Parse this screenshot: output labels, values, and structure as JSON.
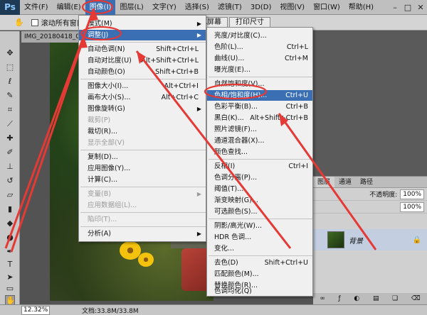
{
  "app": {
    "logo": "Ps"
  },
  "menubar": {
    "items": [
      "文件(F)",
      "编辑(E)",
      "图像(I)",
      "图层(L)",
      "文字(Y)",
      "选择(S)",
      "滤镜(T)",
      "3D(D)",
      "视图(V)",
      "窗口(W)",
      "帮助(H)"
    ],
    "active_index": 2,
    "window_controls": [
      "–",
      "□",
      "✕"
    ]
  },
  "options": {
    "scroll_all_label": "滚动所有窗口",
    "btn_fill_screen": "填充屏幕",
    "btn_print_size": "打印尺寸"
  },
  "document": {
    "tab_title": "IMG_20180418_0"
  },
  "image_menu": {
    "items": [
      {
        "label": "模式(M)",
        "shortcut": "",
        "submenu": true,
        "disabled": false,
        "highlight": false
      },
      {
        "label": "调整(J)",
        "shortcut": "",
        "submenu": true,
        "disabled": false,
        "highlight": true
      },
      {
        "label": "自动色调(N)",
        "shortcut": "Shift+Ctrl+L",
        "submenu": false,
        "disabled": false,
        "highlight": false
      },
      {
        "label": "自动对比度(U)",
        "shortcut": "Alt+Shift+Ctrl+L",
        "submenu": false,
        "disabled": false,
        "highlight": false
      },
      {
        "label": "自动颜色(O)",
        "shortcut": "Shift+Ctrl+B",
        "submenu": false,
        "disabled": false,
        "highlight": false
      },
      {
        "label": "图像大小(I)...",
        "shortcut": "Alt+Ctrl+I",
        "submenu": false,
        "disabled": false,
        "highlight": false
      },
      {
        "label": "画布大小(S)...",
        "shortcut": "Alt+Ctrl+C",
        "submenu": false,
        "disabled": false,
        "highlight": false
      },
      {
        "label": "图像旋转(G)",
        "shortcut": "",
        "submenu": true,
        "disabled": false,
        "highlight": false
      },
      {
        "label": "裁剪(P)",
        "shortcut": "",
        "submenu": false,
        "disabled": true,
        "highlight": false
      },
      {
        "label": "裁切(R)...",
        "shortcut": "",
        "submenu": false,
        "disabled": false,
        "highlight": false
      },
      {
        "label": "显示全部(V)",
        "shortcut": "",
        "submenu": false,
        "disabled": true,
        "highlight": false
      },
      {
        "label": "复制(D)...",
        "shortcut": "",
        "submenu": false,
        "disabled": false,
        "highlight": false
      },
      {
        "label": "应用图像(Y)...",
        "shortcut": "",
        "submenu": false,
        "disabled": false,
        "highlight": false
      },
      {
        "label": "计算(C)...",
        "shortcut": "",
        "submenu": false,
        "disabled": false,
        "highlight": false
      },
      {
        "label": "变量(B)",
        "shortcut": "",
        "submenu": true,
        "disabled": true,
        "highlight": false
      },
      {
        "label": "应用数据组(L)...",
        "shortcut": "",
        "submenu": false,
        "disabled": true,
        "highlight": false
      },
      {
        "label": "陷印(T)...",
        "shortcut": "",
        "submenu": false,
        "disabled": true,
        "highlight": false
      },
      {
        "label": "分析(A)",
        "shortcut": "",
        "submenu": true,
        "disabled": false,
        "highlight": false
      }
    ]
  },
  "adjust_menu": {
    "items": [
      {
        "label": "亮度/对比度(C)...",
        "shortcut": "",
        "disabled": false,
        "highlight": false
      },
      {
        "label": "色阶(L)...",
        "shortcut": "Ctrl+L",
        "disabled": false,
        "highlight": false
      },
      {
        "label": "曲线(U)...",
        "shortcut": "Ctrl+M",
        "disabled": false,
        "highlight": false
      },
      {
        "label": "曝光度(E)...",
        "shortcut": "",
        "disabled": false,
        "highlight": false
      },
      {
        "label": "自然饱和度(V)...",
        "shortcut": "",
        "disabled": false,
        "highlight": false
      },
      {
        "label": "色相/饱和度(H)...",
        "shortcut": "Ctrl+U",
        "disabled": false,
        "highlight": true
      },
      {
        "label": "色彩平衡(B)...",
        "shortcut": "Ctrl+B",
        "disabled": false,
        "highlight": false
      },
      {
        "label": "黑白(K)...",
        "shortcut": "Alt+Shift+Ctrl+B",
        "disabled": false,
        "highlight": false
      },
      {
        "label": "照片滤镜(F)...",
        "shortcut": "",
        "disabled": false,
        "highlight": false
      },
      {
        "label": "通道混合器(X)...",
        "shortcut": "",
        "disabled": false,
        "highlight": false
      },
      {
        "label": "颜色查找...",
        "shortcut": "",
        "disabled": false,
        "highlight": false
      },
      {
        "label": "反相(I)",
        "shortcut": "Ctrl+I",
        "disabled": false,
        "highlight": false
      },
      {
        "label": "色调分离(P)...",
        "shortcut": "",
        "disabled": false,
        "highlight": false
      },
      {
        "label": "阈值(T)...",
        "shortcut": "",
        "disabled": false,
        "highlight": false
      },
      {
        "label": "渐变映射(G)...",
        "shortcut": "",
        "disabled": false,
        "highlight": false
      },
      {
        "label": "可选颜色(S)...",
        "shortcut": "",
        "disabled": false,
        "highlight": false
      },
      {
        "label": "阴影/高光(W)...",
        "shortcut": "",
        "disabled": false,
        "highlight": false
      },
      {
        "label": "HDR 色调...",
        "shortcut": "",
        "disabled": false,
        "highlight": false
      },
      {
        "label": "变化...",
        "shortcut": "",
        "disabled": false,
        "highlight": false
      },
      {
        "label": "去色(D)",
        "shortcut": "Shift+Ctrl+U",
        "disabled": false,
        "highlight": false
      },
      {
        "label": "匹配颜色(M)...",
        "shortcut": "",
        "disabled": false,
        "highlight": false
      },
      {
        "label": "替换颜色(R)...",
        "shortcut": "",
        "disabled": false,
        "highlight": false
      },
      {
        "label": "色调均化(Q)",
        "shortcut": "",
        "disabled": false,
        "highlight": false
      }
    ]
  },
  "layers_panel": {
    "tabs": [
      "图层",
      "通道",
      "路径"
    ],
    "opacity_label": "不透明度:",
    "opacity_value": "100%",
    "fill_value": "100%",
    "layer_name": "背景"
  },
  "status": {
    "zoom": "12.32%",
    "doc_info": "文档:33.8M/33.8M"
  },
  "colors": {
    "highlight": "#3a6fb3",
    "annotation": "#e53935"
  }
}
